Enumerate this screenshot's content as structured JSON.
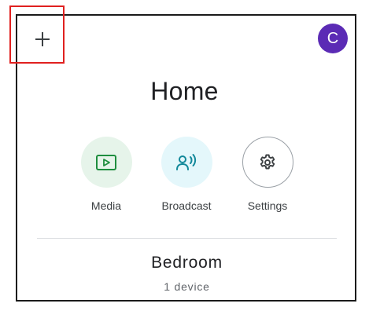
{
  "header": {
    "add_icon": "plus-icon",
    "avatar_letter": "C"
  },
  "page": {
    "title": "Home"
  },
  "actions": [
    {
      "label": "Media",
      "icon": "media-play-icon",
      "bg": "#e6f4ea",
      "color": "#1e8e3e"
    },
    {
      "label": "Broadcast",
      "icon": "broadcast-icon",
      "bg": "#e4f7fb",
      "color": "#12889a"
    },
    {
      "label": "Settings",
      "icon": "gear-icon",
      "bg": "#ffffff",
      "color": "#3c4043"
    }
  ],
  "room": {
    "name": "Bedroom",
    "device_count": "1 device"
  },
  "colors": {
    "avatar": "#5b2bb5",
    "highlight": "#e0201f",
    "frame": "#1a1a1a"
  }
}
